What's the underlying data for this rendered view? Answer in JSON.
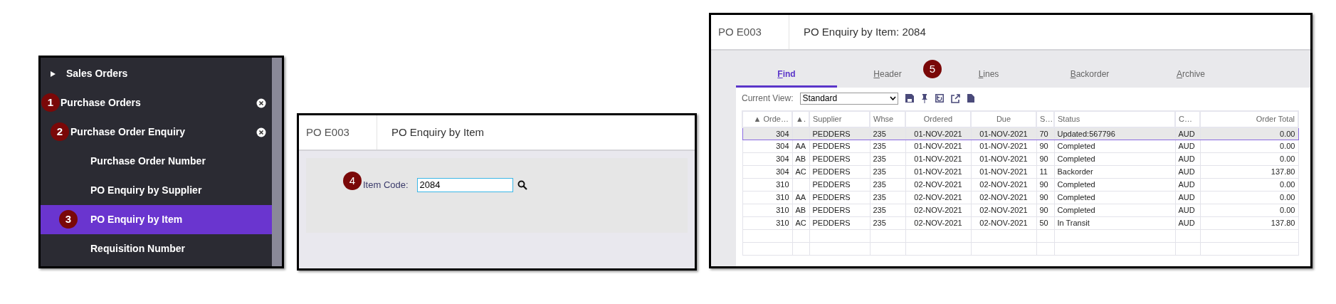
{
  "navigation": {
    "items": [
      {
        "label": "Sales Orders",
        "expanded": false,
        "selected": false
      },
      {
        "label": "Purchase Orders",
        "expanded": true,
        "selected": false,
        "callout": "1",
        "children": [
          {
            "label": "Purchase Order Enquiry",
            "expanded": true,
            "selected": false,
            "callout": "2",
            "children": [
              {
                "label": "Purchase Order Number",
                "selected": false
              },
              {
                "label": "PO Enquiry by Supplier",
                "selected": false
              },
              {
                "label": "PO Enquiry by Item",
                "selected": true,
                "callout": "3"
              },
              {
                "label": "Requisition Number",
                "selected": false
              }
            ]
          }
        ]
      }
    ]
  },
  "search_form": {
    "code": "PO E003",
    "title": "PO Enquiry by Item",
    "field": {
      "label": "Item Code:",
      "value": "2084",
      "callout": "4"
    }
  },
  "results": {
    "code": "PO E003",
    "title": "PO Enquiry by Item: 2084",
    "tabs": [
      {
        "label": "Find",
        "selected": true
      },
      {
        "label": "Header",
        "selected": false
      },
      {
        "label": "Lines",
        "selected": false
      },
      {
        "label": "Backorder",
        "selected": false
      },
      {
        "label": "Archive",
        "selected": false
      }
    ],
    "tabs_callout": "5",
    "view": {
      "label": "Current View:",
      "value": "Standard"
    },
    "table": {
      "columns": [
        "▲ Orde…",
        "▲.",
        "Supplier",
        "Whse",
        "Ordered",
        "Due",
        "S…",
        "Status",
        "C…",
        "Order Total"
      ],
      "rows": [
        {
          "selected": true,
          "cells": [
            "304",
            "",
            "PEDDERS",
            "235",
            "01-NOV-2021",
            "01-NOV-2021",
            "70",
            "Updated:567796",
            "AUD",
            "0.00"
          ]
        },
        {
          "selected": false,
          "cells": [
            "304",
            "AA",
            "PEDDERS",
            "235",
            "01-NOV-2021",
            "01-NOV-2021",
            "90",
            "Completed",
            "AUD",
            "0.00"
          ]
        },
        {
          "selected": false,
          "cells": [
            "304",
            "AB",
            "PEDDERS",
            "235",
            "01-NOV-2021",
            "01-NOV-2021",
            "90",
            "Completed",
            "AUD",
            "0.00"
          ]
        },
        {
          "selected": false,
          "cells": [
            "304",
            "AC",
            "PEDDERS",
            "235",
            "01-NOV-2021",
            "01-NOV-2021",
            "11",
            "Backorder",
            "AUD",
            "137.80"
          ]
        },
        {
          "selected": false,
          "cells": [
            "310",
            "",
            "PEDDERS",
            "235",
            "02-NOV-2021",
            "02-NOV-2021",
            "90",
            "Completed",
            "AUD",
            "0.00"
          ]
        },
        {
          "selected": false,
          "cells": [
            "310",
            "AA",
            "PEDDERS",
            "235",
            "02-NOV-2021",
            "02-NOV-2021",
            "90",
            "Completed",
            "AUD",
            "0.00"
          ]
        },
        {
          "selected": false,
          "cells": [
            "310",
            "AB",
            "PEDDERS",
            "235",
            "02-NOV-2021",
            "02-NOV-2021",
            "90",
            "Completed",
            "AUD",
            "0.00"
          ]
        },
        {
          "selected": false,
          "cells": [
            "310",
            "AC",
            "PEDDERS",
            "235",
            "02-NOV-2021",
            "02-NOV-2021",
            "50",
            "In Transit",
            "AUD",
            "137.80"
          ]
        }
      ]
    }
  }
}
